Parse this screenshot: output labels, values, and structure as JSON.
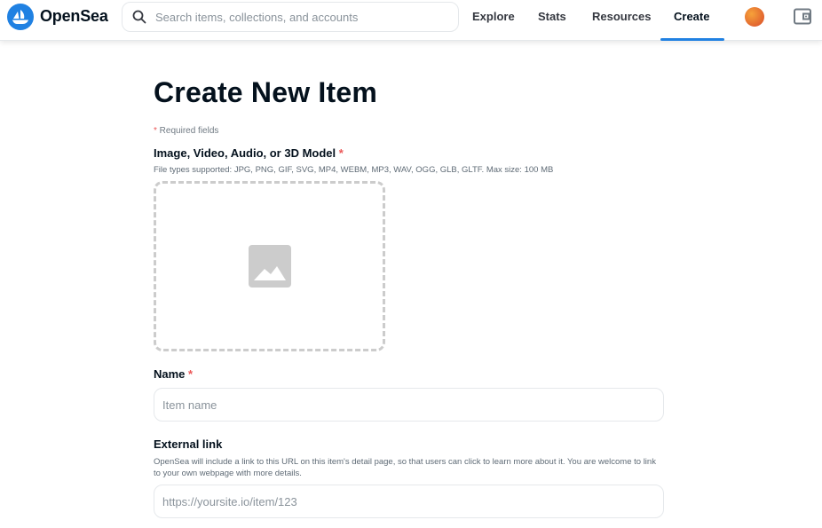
{
  "header": {
    "brand": "OpenSea",
    "search_placeholder": "Search items, collections, and accounts",
    "nav": {
      "explore": "Explore",
      "stats": "Stats",
      "resources": "Resources",
      "create": "Create"
    },
    "active_tab": "create",
    "icons": [
      "opensea-logo-icon",
      "search-icon",
      "avatar",
      "wallet-icon"
    ],
    "colors": {
      "accent": "#2081e2",
      "logo_bg": "#2081e2",
      "required": "#eb5757"
    }
  },
  "form": {
    "title": "Create New Item",
    "required_note": {
      "star": "*",
      "text": " Required fields"
    },
    "media": {
      "label": "Image, Video, Audio, or 3D Model",
      "star": "*",
      "helper": "File types supported: JPG, PNG, GIF, SVG, MP4, WEBM, MP3, WAV, OGG, GLB, GLTF. Max size: 100 MB",
      "icon": "image-icon"
    },
    "name": {
      "label": "Name",
      "star": "*",
      "placeholder": "Item name",
      "value": ""
    },
    "external_link": {
      "label": "External link",
      "helper": "OpenSea will include a link to this URL on this item's detail page, so that users can click to learn more about it. You are welcome to link to your own webpage with more details.",
      "placeholder": "https://yoursite.io/item/123",
      "value": ""
    }
  }
}
